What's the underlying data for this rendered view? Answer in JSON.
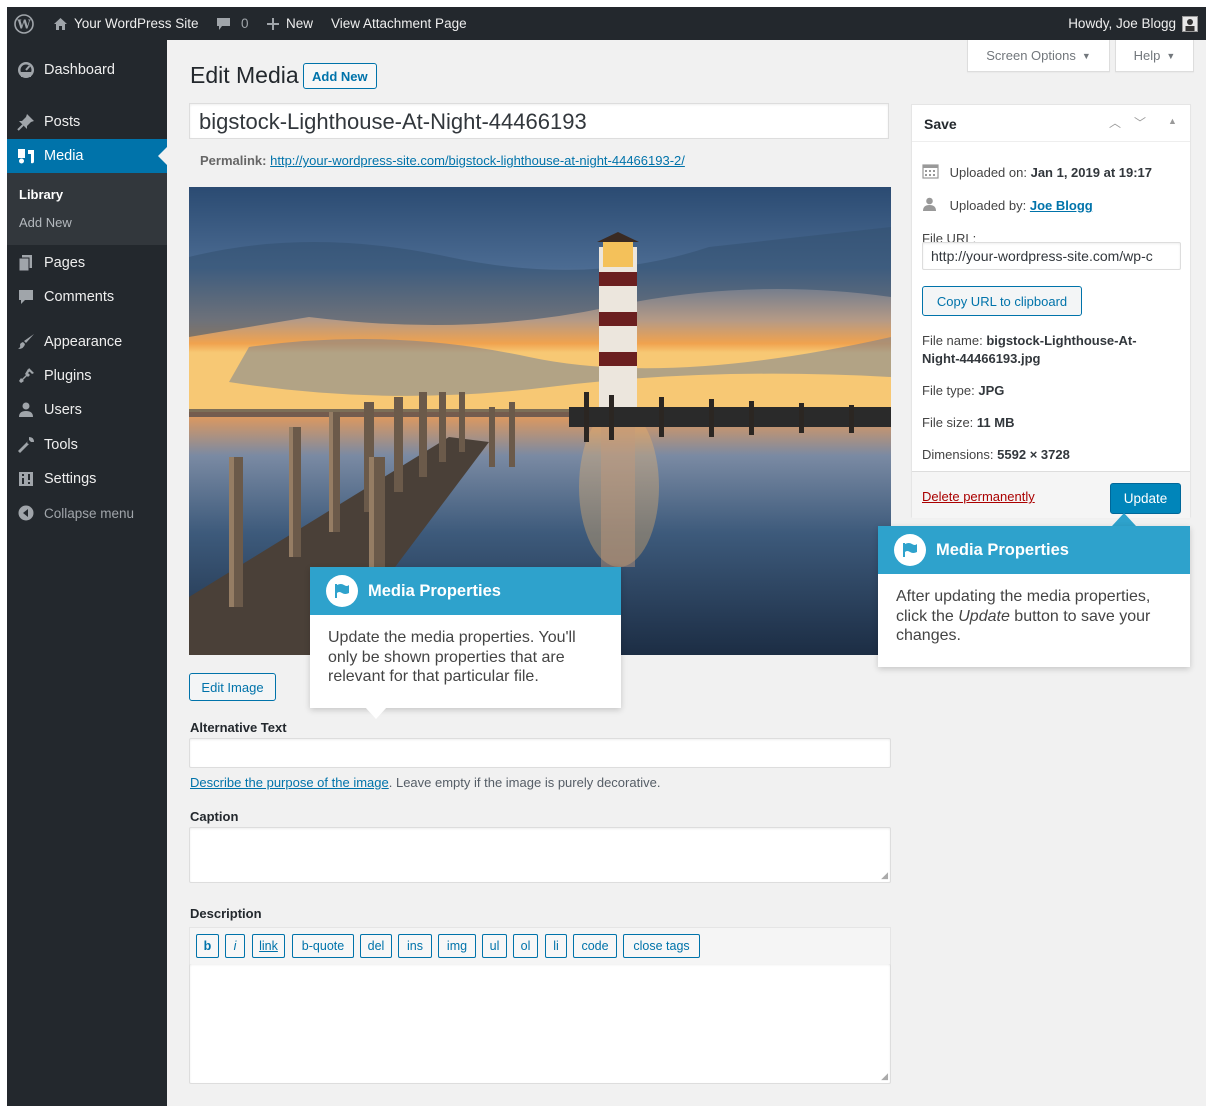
{
  "colors": {
    "accent": "#0073aa",
    "adminbar": "#23282d",
    "callout": "#2ea2cc",
    "delete": "#a00000"
  },
  "admin_bar": {
    "wp_logo_icon": "wordpress-logo-icon",
    "site_name": "Your WordPress Site",
    "comments_count": "0",
    "new_label": "New",
    "view_label": "View Attachment Page",
    "howdy": "Howdy, Joe Blogg"
  },
  "sidebar": {
    "items": [
      {
        "label": "Dashboard",
        "icon": "dashboard-icon"
      },
      {
        "label": "Posts",
        "icon": "pushpin-icon"
      },
      {
        "label": "Media",
        "icon": "media-icon"
      },
      {
        "label": "Pages",
        "icon": "pages-icon"
      },
      {
        "label": "Comments",
        "icon": "comment-icon"
      },
      {
        "label": "Appearance",
        "icon": "brush-icon"
      },
      {
        "label": "Plugins",
        "icon": "plugin-icon"
      },
      {
        "label": "Users",
        "icon": "users-icon"
      },
      {
        "label": "Tools",
        "icon": "wrench-icon"
      },
      {
        "label": "Settings",
        "icon": "settings-icon"
      }
    ],
    "submenu": [
      "Library",
      "Add New"
    ],
    "collapse": "Collapse menu"
  },
  "top_tabs": {
    "screen_options": "Screen Options",
    "help": "Help"
  },
  "header": {
    "title": "Edit Media",
    "add_new": "Add New"
  },
  "media": {
    "title": "bigstock-Lighthouse-At-Night-44466193",
    "permalink_label": "Permalink:",
    "permalink_url": "http://your-wordpress-site.com/bigstock-lighthouse-at-night-44466193-2/",
    "edit_image": "Edit Image"
  },
  "fields": {
    "alt_label": "Alternative Text",
    "alt_help_link": "Describe the purpose of the image",
    "alt_help_rest": ". Leave empty if the image is purely decorative.",
    "caption_label": "Caption",
    "description_label": "Description",
    "quicktags": [
      "b",
      "i",
      "link",
      "b-quote",
      "del",
      "ins",
      "img",
      "ul",
      "ol",
      "li",
      "code",
      "close tags"
    ]
  },
  "save_box": {
    "title": "Save",
    "uploaded_on_label": "Uploaded on:",
    "uploaded_on": "Jan 1, 2019 at 19:17",
    "uploaded_by_label": "Uploaded by:",
    "uploaded_by": "Joe Blogg",
    "file_url_label": "File URL:",
    "file_url": "http://your-wordpress-site.com/wp-c",
    "copy_url": "Copy URL to clipboard",
    "file_name_label": "File name:",
    "file_name_1": "bigstock-Lighthouse-At-",
    "file_name_2": "Night-44466193.jpg",
    "file_type_label": "File type:",
    "file_type": "JPG",
    "file_size_label": "File size:",
    "file_size": "11 MB",
    "dimensions_label": "Dimensions:",
    "dimensions": "5592 × 3728",
    "delete": "Delete permanently",
    "update": "Update"
  },
  "callouts": {
    "left": {
      "title": "Media Properties",
      "lines": [
        "Update the media properties. You'll",
        "only be shown properties that are",
        "relevant for that particular file."
      ]
    },
    "right": {
      "title": "Media Properties",
      "line1": "After updating the media properties,",
      "line2_pre": "click the ",
      "line2_em": "Update",
      "line2_post": " button to save your",
      "line3": "changes."
    }
  }
}
